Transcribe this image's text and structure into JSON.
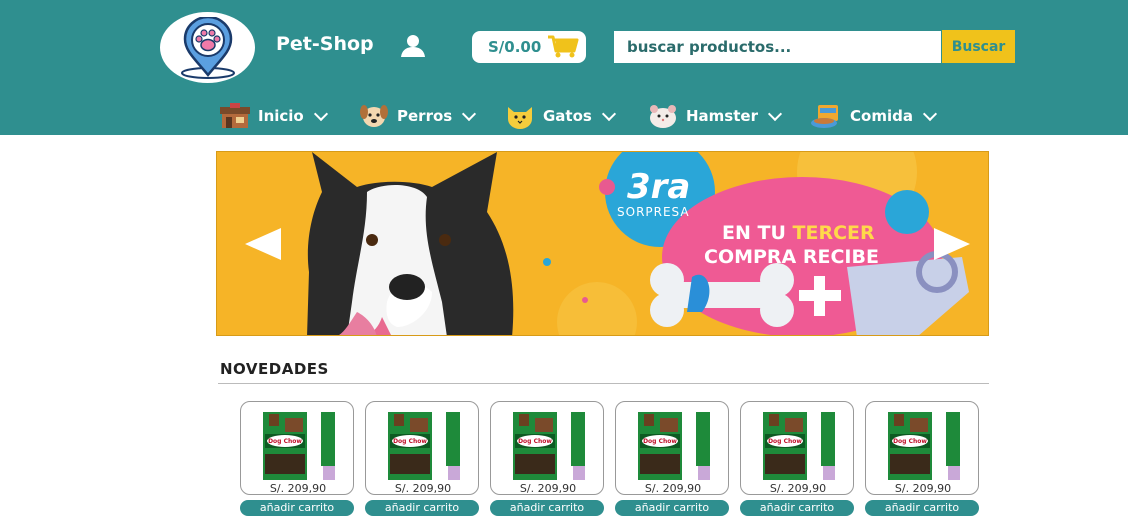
{
  "header": {
    "brand": "Pet-Shop",
    "cart_total": "S/0.00",
    "search_placeholder": "buscar productos...",
    "search_button": "Buscar"
  },
  "nav": [
    {
      "label": "Inicio",
      "icon": "house-icon"
    },
    {
      "label": "Perros",
      "icon": "dog-icon"
    },
    {
      "label": "Gatos",
      "icon": "cat-icon"
    },
    {
      "label": "Hamster",
      "icon": "hamster-icon"
    },
    {
      "label": "Comida",
      "icon": "food-icon"
    }
  ],
  "banner": {
    "badge_number": "3ra",
    "badge_word": "SORPRESA",
    "line1_a": "EN TU ",
    "line1_b": "TERCER",
    "line2": "COMPRA RECIBE"
  },
  "section": {
    "title": "NOVEDADES"
  },
  "products": [
    {
      "brand": "Dog Chow",
      "price": "S/. 209,90",
      "button": "añadir carrito"
    },
    {
      "brand": "Dog Chow",
      "price": "S/. 209,90",
      "button": "añadir carrito"
    },
    {
      "brand": "Dog Chow",
      "price": "S/. 209,90",
      "button": "añadir carrito"
    },
    {
      "brand": "Dog Chow",
      "price": "S/. 209,90",
      "button": "añadir carrito"
    },
    {
      "brand": "Dog Chow",
      "price": "S/. 209,90",
      "button": "añadir carrito"
    },
    {
      "brand": "Dog Chow",
      "price": "S/. 209,90",
      "button": "añadir carrito"
    }
  ],
  "colors": {
    "header": "#2f8f8f",
    "accent": "#f0c21b",
    "banner": "#f6b427"
  }
}
